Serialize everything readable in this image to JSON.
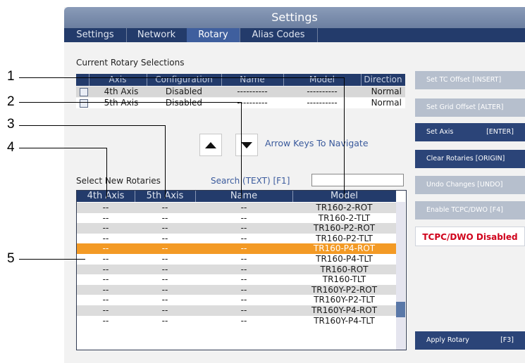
{
  "window": {
    "title": "Settings"
  },
  "tabs": [
    "Settings",
    "Network",
    "Rotary",
    "Alias Codes"
  ],
  "current": {
    "label": "Current Rotary Selections",
    "columns": [
      "Axis",
      "Configuration",
      "Name",
      "Model",
      "Direction"
    ],
    "rows": [
      {
        "axis": "4th Axis",
        "config": "Disabled",
        "name": "----------",
        "model": "----------",
        "direction": "Normal"
      },
      {
        "axis": "5th Axis",
        "config": "Disabled",
        "name": "----------",
        "model": "----------",
        "direction": "Normal"
      }
    ]
  },
  "nav": {
    "hint": "Arrow Keys To Navigate",
    "up_icon": "triangle-up-icon",
    "down_icon": "triangle-down-icon"
  },
  "select_new": {
    "label": "Select New Rotaries",
    "search_label": "Search (TEXT) [F1]",
    "search_value": "",
    "columns": [
      "4th Axis",
      "5th Axis",
      "Name",
      "Model"
    ],
    "rows": [
      {
        "a4": "--",
        "a5": "--",
        "name": "--",
        "model": "TR160-2-ROT"
      },
      {
        "a4": "--",
        "a5": "--",
        "name": "--",
        "model": "TR160-2-TLT"
      },
      {
        "a4": "--",
        "a5": "--",
        "name": "--",
        "model": "TR160-P2-ROT"
      },
      {
        "a4": "--",
        "a5": "--",
        "name": "--",
        "model": "TR160-P2-TLT"
      },
      {
        "a4": "--",
        "a5": "--",
        "name": "--",
        "model": "TR160-P4-ROT"
      },
      {
        "a4": "--",
        "a5": "--",
        "name": "--",
        "model": "TR160-P4-TLT"
      },
      {
        "a4": "--",
        "a5": "--",
        "name": "--",
        "model": "TR160-ROT"
      },
      {
        "a4": "--",
        "a5": "--",
        "name": "--",
        "model": "TR160-TLT"
      },
      {
        "a4": "--",
        "a5": "--",
        "name": "--",
        "model": "TR160Y-P2-ROT"
      },
      {
        "a4": "--",
        "a5": "--",
        "name": "--",
        "model": "TR160Y-P2-TLT"
      },
      {
        "a4": "--",
        "a5": "--",
        "name": "--",
        "model": "TR160Y-P4-ROT"
      },
      {
        "a4": "--",
        "a5": "--",
        "name": "--",
        "model": "TR160Y-P4-TLT"
      }
    ],
    "selected_index": 4
  },
  "side": {
    "set_tc": "Set TC Offset [INSERT]",
    "set_grid": "Set Grid Offset [ALTER]",
    "set_axis": "Set Axis",
    "set_axis_key": "[ENTER]",
    "clear": "Clear Rotaries [ORIGIN]",
    "undo": "Undo Changes [UNDO]",
    "enable_tcpc": "Enable TCPC/DWO [F4]",
    "tcpc_status": "TCPC/DWO Disabled",
    "apply": "Apply Rotary",
    "apply_key": "[F3]"
  },
  "callouts": [
    "1",
    "2",
    "3",
    "4",
    "5"
  ],
  "colors": {
    "header_blue": "#233b6b",
    "highlight_orange": "#f39a25",
    "status_red": "#d0021b"
  }
}
